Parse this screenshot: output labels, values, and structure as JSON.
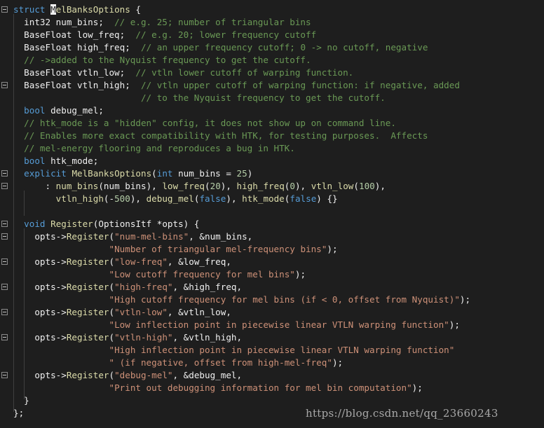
{
  "colors": {
    "background": "#1e1e1e",
    "keyword": "#569cd6",
    "function": "#dcdcaa",
    "comment": "#6a9955",
    "string": "#ce9178",
    "number": "#b5cea8",
    "identifier": "#f0f0f0"
  },
  "icons": {
    "fold": "collapse-minus-icon"
  },
  "watermark": "https://blog.csdn.net/qq_23660243",
  "code_lines": [
    {
      "fold": true,
      "tokens": [
        [
          "kw",
          "struct"
        ],
        [
          "id",
          " "
        ],
        [
          "cur",
          "M"
        ],
        [
          "fn",
          "elBanksOptions"
        ],
        [
          "id",
          " {"
        ]
      ]
    },
    {
      "fold": false,
      "tokens": [
        [
          "id",
          "  int32 num_bins;  "
        ],
        [
          "cm",
          "// e.g. 25; number of triangular bins"
        ]
      ]
    },
    {
      "fold": false,
      "tokens": [
        [
          "id",
          "  BaseFloat low_freq;  "
        ],
        [
          "cm",
          "// e.g. 20; lower frequency cutoff"
        ]
      ]
    },
    {
      "fold": false,
      "tokens": [
        [
          "id",
          "  BaseFloat high_freq;  "
        ],
        [
          "cm",
          "// an upper frequency cutoff; 0 -> no cutoff, negative"
        ]
      ]
    },
    {
      "fold": false,
      "tokens": [
        [
          "cm",
          "  // ->added to the Nyquist frequency to get the cutoff."
        ]
      ]
    },
    {
      "fold": false,
      "tokens": [
        [
          "id",
          "  BaseFloat vtln_low;  "
        ],
        [
          "cm",
          "// vtln lower cutoff of warping function."
        ]
      ]
    },
    {
      "fold": true,
      "tokens": [
        [
          "id",
          "  BaseFloat vtln_high;  "
        ],
        [
          "cm",
          "// vtln upper cutoff of warping function: if negative, added"
        ]
      ]
    },
    {
      "fold": false,
      "tokens": [
        [
          "cm",
          "                        // to the Nyquist frequency to get the cutoff."
        ]
      ]
    },
    {
      "fold": false,
      "tokens": [
        [
          "id",
          "  "
        ],
        [
          "kw",
          "bool"
        ],
        [
          "id",
          " debug_mel;"
        ]
      ]
    },
    {
      "fold": false,
      "tokens": [
        [
          "cm",
          "  // htk_mode is a \"hidden\" config, it does not show up on command line."
        ]
      ]
    },
    {
      "fold": false,
      "tokens": [
        [
          "cm",
          "  // Enables more exact compatibility with HTK, for testing purposes.  Affects"
        ]
      ]
    },
    {
      "fold": false,
      "tokens": [
        [
          "cm",
          "  // mel-energy flooring and reproduces a bug in HTK."
        ]
      ]
    },
    {
      "fold": false,
      "tokens": [
        [
          "id",
          "  "
        ],
        [
          "kw",
          "bool"
        ],
        [
          "id",
          " htk_mode;"
        ]
      ]
    },
    {
      "fold": true,
      "tokens": [
        [
          "id",
          "  "
        ],
        [
          "kw",
          "explicit"
        ],
        [
          "id",
          " "
        ],
        [
          "fn",
          "MelBanksOptions"
        ],
        [
          "id",
          "("
        ],
        [
          "kw",
          "int"
        ],
        [
          "id",
          " num_bins = "
        ],
        [
          "num",
          "25"
        ],
        [
          "id",
          ")"
        ]
      ]
    },
    {
      "fold": true,
      "tokens": [
        [
          "id",
          "      : "
        ],
        [
          "fn",
          "num_bins"
        ],
        [
          "id",
          "(num_bins), "
        ],
        [
          "fn",
          "low_freq"
        ],
        [
          "id",
          "("
        ],
        [
          "num",
          "20"
        ],
        [
          "id",
          "), "
        ],
        [
          "fn",
          "high_freq"
        ],
        [
          "id",
          "("
        ],
        [
          "num",
          "0"
        ],
        [
          "id",
          "), "
        ],
        [
          "fn",
          "vtln_low"
        ],
        [
          "id",
          "("
        ],
        [
          "num",
          "100"
        ],
        [
          "id",
          "),"
        ]
      ]
    },
    {
      "fold": false,
      "tokens": [
        [
          "id",
          "        "
        ],
        [
          "fn",
          "vtln_high"
        ],
        [
          "id",
          "(-"
        ],
        [
          "num",
          "500"
        ],
        [
          "id",
          "), "
        ],
        [
          "fn",
          "debug_mel"
        ],
        [
          "id",
          "("
        ],
        [
          "kw",
          "false"
        ],
        [
          "id",
          "), "
        ],
        [
          "fn",
          "htk_mode"
        ],
        [
          "id",
          "("
        ],
        [
          "kw",
          "false"
        ],
        [
          "id",
          ") {}"
        ]
      ]
    },
    {
      "fold": false,
      "tokens": [
        [
          "id",
          " "
        ]
      ]
    },
    {
      "fold": true,
      "tokens": [
        [
          "id",
          "  "
        ],
        [
          "kw",
          "void"
        ],
        [
          "id",
          " "
        ],
        [
          "fn",
          "Register"
        ],
        [
          "id",
          "(OptionsItf *opts) {"
        ]
      ]
    },
    {
      "fold": true,
      "tokens": [
        [
          "id",
          "    opts->"
        ],
        [
          "fn",
          "Register"
        ],
        [
          "id",
          "("
        ],
        [
          "str",
          "\"num-mel-bins\""
        ],
        [
          "id",
          ", &num_bins,"
        ]
      ]
    },
    {
      "fold": false,
      "tokens": [
        [
          "id",
          "                  "
        ],
        [
          "str",
          "\"Number of triangular mel-frequency bins\""
        ],
        [
          "id",
          ");"
        ]
      ]
    },
    {
      "fold": true,
      "tokens": [
        [
          "id",
          "    opts->"
        ],
        [
          "fn",
          "Register"
        ],
        [
          "id",
          "("
        ],
        [
          "str",
          "\"low-freq\""
        ],
        [
          "id",
          ", &low_freq,"
        ]
      ]
    },
    {
      "fold": false,
      "tokens": [
        [
          "id",
          "                  "
        ],
        [
          "str",
          "\"Low cutoff frequency for mel bins\""
        ],
        [
          "id",
          ");"
        ]
      ]
    },
    {
      "fold": true,
      "tokens": [
        [
          "id",
          "    opts->"
        ],
        [
          "fn",
          "Register"
        ],
        [
          "id",
          "("
        ],
        [
          "str",
          "\"high-freq\""
        ],
        [
          "id",
          ", &high_freq,"
        ]
      ]
    },
    {
      "fold": false,
      "tokens": [
        [
          "id",
          "                  "
        ],
        [
          "str",
          "\"High cutoff frequency for mel bins (if < 0, offset from Nyquist)\""
        ],
        [
          "id",
          ");"
        ]
      ]
    },
    {
      "fold": true,
      "tokens": [
        [
          "id",
          "    opts->"
        ],
        [
          "fn",
          "Register"
        ],
        [
          "id",
          "("
        ],
        [
          "str",
          "\"vtln-low\""
        ],
        [
          "id",
          ", &vtln_low,"
        ]
      ]
    },
    {
      "fold": false,
      "tokens": [
        [
          "id",
          "                  "
        ],
        [
          "str",
          "\"Low inflection point in piecewise linear VTLN warping function\""
        ],
        [
          "id",
          ");"
        ]
      ]
    },
    {
      "fold": true,
      "tokens": [
        [
          "id",
          "    opts->"
        ],
        [
          "fn",
          "Register"
        ],
        [
          "id",
          "("
        ],
        [
          "str",
          "\"vtln-high\""
        ],
        [
          "id",
          ", &vtln_high,"
        ]
      ]
    },
    {
      "fold": false,
      "tokens": [
        [
          "id",
          "                  "
        ],
        [
          "str",
          "\"High inflection point in piecewise linear VTLN warping function\""
        ]
      ]
    },
    {
      "fold": false,
      "tokens": [
        [
          "id",
          "                  "
        ],
        [
          "str",
          "\" (if negative, offset from high-mel-freq\""
        ],
        [
          "id",
          ");"
        ]
      ]
    },
    {
      "fold": true,
      "tokens": [
        [
          "id",
          "    opts->"
        ],
        [
          "fn",
          "Register"
        ],
        [
          "id",
          "("
        ],
        [
          "str",
          "\"debug-mel\""
        ],
        [
          "id",
          ", &debug_mel,"
        ]
      ]
    },
    {
      "fold": false,
      "tokens": [
        [
          "id",
          "                  "
        ],
        [
          "str",
          "\"Print out debugging information for mel bin computation\""
        ],
        [
          "id",
          ");"
        ]
      ]
    },
    {
      "fold": false,
      "tokens": [
        [
          "id",
          "  }"
        ]
      ]
    },
    {
      "fold": false,
      "tokens": [
        [
          "id",
          "};"
        ]
      ]
    }
  ]
}
